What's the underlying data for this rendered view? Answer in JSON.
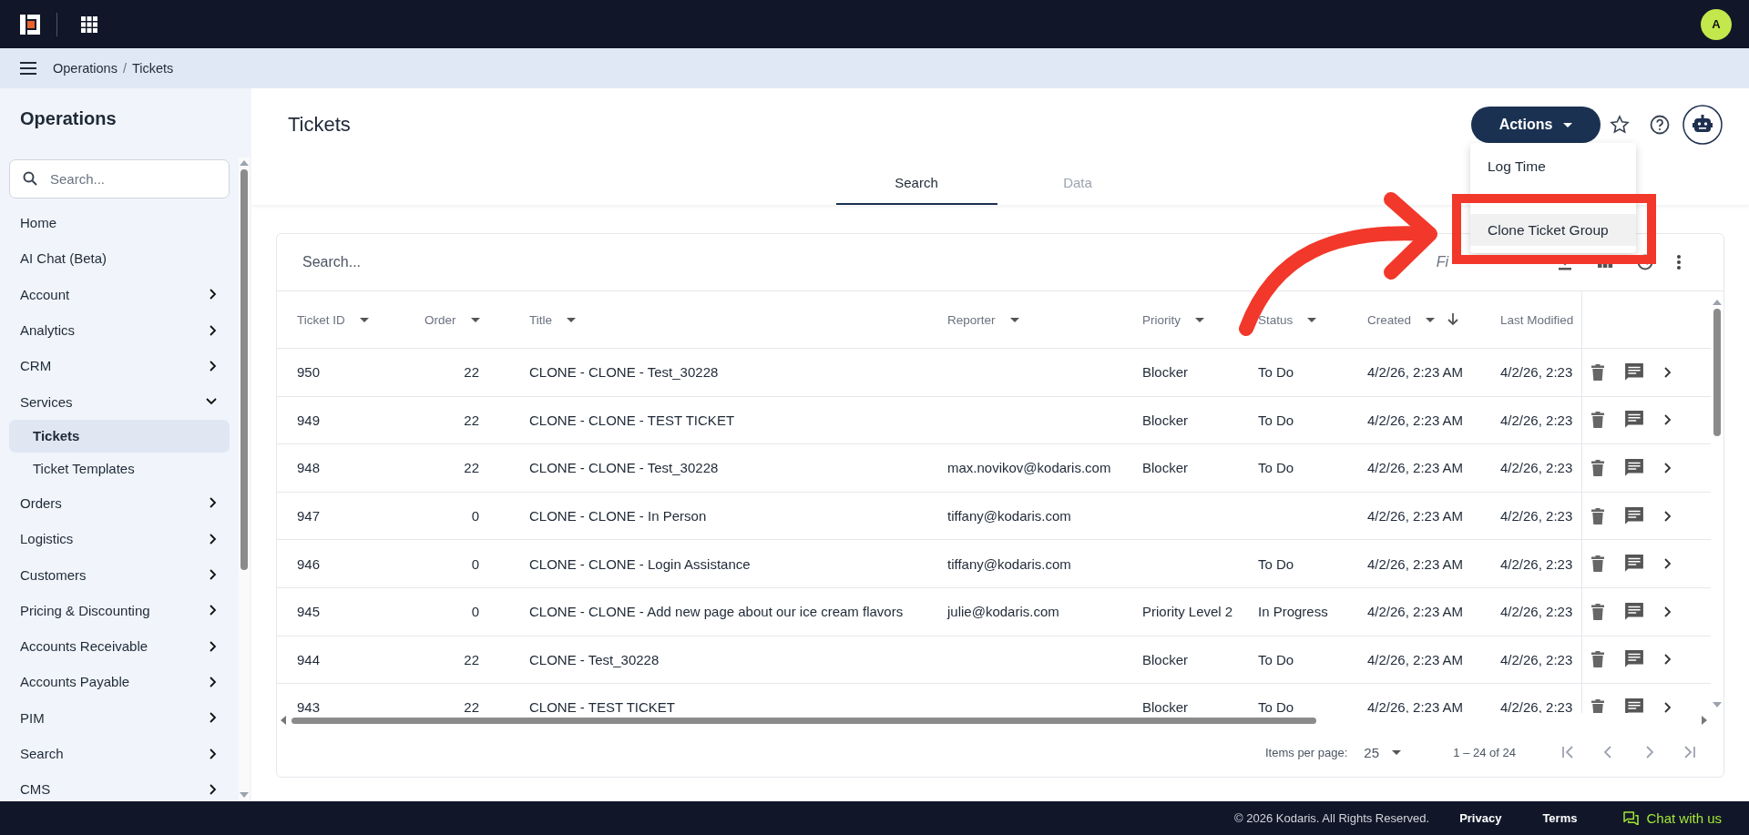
{
  "topbar": {
    "avatar": "A"
  },
  "breadcrumb": {
    "items": [
      "Operations",
      "Tickets"
    ],
    "separator": "/"
  },
  "sidebar": {
    "title": "Operations",
    "search": {
      "placeholder": "Search..."
    },
    "items": [
      {
        "label": "Home",
        "selected": false
      },
      {
        "label": "AI Chat (Beta)",
        "selected": false
      },
      {
        "label": "Account",
        "expanded": false,
        "selected": false
      },
      {
        "label": "Analytics",
        "expanded": false,
        "selected": false
      },
      {
        "label": "CRM",
        "expanded": false,
        "selected": false
      },
      {
        "label": "Services",
        "expanded": true,
        "selected": false,
        "children": [
          {
            "label": "Tickets",
            "selected": true
          },
          {
            "label": "Ticket Templates",
            "selected": false
          }
        ]
      },
      {
        "label": "Orders",
        "expanded": false,
        "selected": false
      },
      {
        "label": "Logistics",
        "expanded": false,
        "selected": false
      },
      {
        "label": "Customers",
        "expanded": false,
        "selected": false
      },
      {
        "label": "Pricing & Discounting",
        "expanded": false,
        "selected": false
      },
      {
        "label": "Accounts Receivable",
        "expanded": false,
        "selected": false
      },
      {
        "label": "Accounts Payable",
        "expanded": false,
        "selected": false
      },
      {
        "label": "PIM",
        "expanded": false,
        "selected": false
      },
      {
        "label": "Search",
        "expanded": false,
        "selected": false
      },
      {
        "label": "CMS",
        "expanded": false,
        "selected": false
      }
    ]
  },
  "page": {
    "title": "Tickets",
    "actions_button": "Actions",
    "actions_menu": [
      {
        "label": "Log Time",
        "highlighted": false
      },
      {
        "label": "Clone Ticket Group",
        "highlighted": true
      }
    ]
  },
  "tabs": [
    {
      "label": "Search",
      "selected": true
    },
    {
      "label": "Data",
      "selected": false
    }
  ],
  "table": {
    "search": {
      "placeholder": "Search..."
    },
    "filters": "Fi",
    "columns": [
      {
        "label": "Ticket ID"
      },
      {
        "label": "Order"
      },
      {
        "label": "Title"
      },
      {
        "label": "Reporter"
      },
      {
        "label": "Priority"
      },
      {
        "label": "Status"
      },
      {
        "label": "Created",
        "sorted_descending": true
      },
      {
        "label": "Last Modified"
      }
    ],
    "rows": [
      {
        "id": "950",
        "order": "22",
        "title": "CLONE - CLONE - Test_30228",
        "priority": "Blocker",
        "status": "To Do",
        "created": "4/2/26, 2:23 AM",
        "modified": "4/2/26, 2:23"
      },
      {
        "id": "949",
        "order": "22",
        "title": "CLONE - CLONE - TEST TICKET",
        "priority": "Blocker",
        "status": "To Do",
        "created": "4/2/26, 2:23 AM",
        "modified": "4/2/26, 2:23"
      },
      {
        "id": "948",
        "order": "22",
        "title": "CLONE - CLONE - Test_30228",
        "reporter": "max.novikov@kodaris.com",
        "priority": "Blocker",
        "status": "To Do",
        "created": "4/2/26, 2:23 AM",
        "modified": "4/2/26, 2:23"
      },
      {
        "id": "947",
        "order": "0",
        "title": "CLONE - CLONE - In Person",
        "reporter": "tiffany@kodaris.com",
        "created": "4/2/26, 2:23 AM",
        "modified": "4/2/26, 2:23"
      },
      {
        "id": "946",
        "order": "0",
        "title": "CLONE - CLONE - Login Assistance",
        "reporter": "tiffany@kodaris.com",
        "status": "To Do",
        "created": "4/2/26, 2:23 AM",
        "modified": "4/2/26, 2:23"
      },
      {
        "id": "945",
        "order": "0",
        "title": "CLONE - CLONE - Add new page about our ice cream flavors",
        "reporter": "julie@kodaris.com",
        "priority": "Priority Level 2",
        "status": "In Progress",
        "created": "4/2/26, 2:23 AM",
        "modified": "4/2/26, 2:23"
      },
      {
        "id": "944",
        "order": "22",
        "title": "CLONE - Test_30228",
        "priority": "Blocker",
        "status": "To Do",
        "created": "4/2/26, 2:23 AM",
        "modified": "4/2/26, 2:23"
      },
      {
        "id": "943",
        "order": "22",
        "title": "CLONE - TEST TICKET",
        "priority": "Blocker",
        "status": "To Do",
        "created": "4/2/26, 2:23 AM",
        "modified": "4/2/26, 2:23"
      }
    ],
    "pagination": {
      "items_per_page_label": "Items per page:",
      "items_per_page": "25",
      "range": "1 – 24 of 24"
    }
  },
  "footer": {
    "copyright": "© 2026 Kodaris. All Rights Reserved.",
    "links": [
      "Privacy",
      "Terms"
    ],
    "chat": "Chat with us"
  }
}
